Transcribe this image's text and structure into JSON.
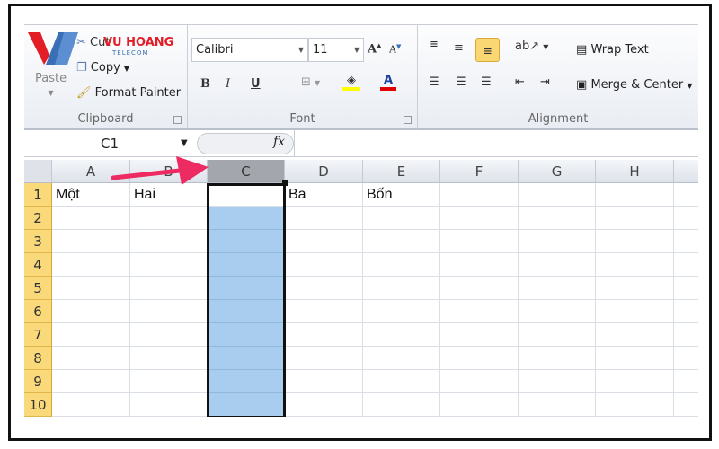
{
  "clipboard": {
    "cut": "Cut",
    "copy": "Copy",
    "paste": "Paste",
    "format_painter": "Format Painter",
    "label": "Clipboard"
  },
  "logo": {
    "brand": "VU HOANG",
    "sub": "TELECOM"
  },
  "font": {
    "name": "Calibri",
    "size": "11",
    "bold": "B",
    "italic": "I",
    "underline": "U",
    "label": "Font",
    "highlight_color": "#ffff00",
    "font_color": "#e00000"
  },
  "alignment": {
    "wrap_text": "Wrap Text",
    "merge_center": "Merge & Center",
    "label": "Alignment"
  },
  "formula_bar": {
    "name_box": "C1",
    "fx": "fx",
    "value": ""
  },
  "columns": [
    "A",
    "B",
    "C",
    "D",
    "E",
    "F",
    "G",
    "H"
  ],
  "selected_column": "C",
  "rows": [
    {
      "n": "1",
      "cells": [
        "Một",
        "Hai",
        "",
        "Ba",
        "Bốn",
        "",
        "",
        ""
      ]
    },
    {
      "n": "2",
      "cells": [
        "",
        "",
        "",
        "",
        "",
        "",
        "",
        ""
      ]
    },
    {
      "n": "3",
      "cells": [
        "",
        "",
        "",
        "",
        "",
        "",
        "",
        ""
      ]
    },
    {
      "n": "4",
      "cells": [
        "",
        "",
        "",
        "",
        "",
        "",
        "",
        ""
      ]
    },
    {
      "n": "5",
      "cells": [
        "",
        "",
        "",
        "",
        "",
        "",
        "",
        ""
      ]
    },
    {
      "n": "6",
      "cells": [
        "",
        "",
        "",
        "",
        "",
        "",
        "",
        ""
      ]
    },
    {
      "n": "7",
      "cells": [
        "",
        "",
        "",
        "",
        "",
        "",
        "",
        ""
      ]
    },
    {
      "n": "8",
      "cells": [
        "",
        "",
        "",
        "",
        "",
        "",
        "",
        ""
      ]
    },
    {
      "n": "9",
      "cells": [
        "",
        "",
        "",
        "",
        "",
        "",
        "",
        ""
      ]
    },
    {
      "n": "10",
      "cells": [
        "",
        "",
        "",
        "",
        "",
        "",
        "",
        ""
      ]
    }
  ],
  "colors": {
    "selection": "#a8cdef",
    "row_header": "#f9d97a",
    "arrow": "#ee2a62",
    "active_button": "#fbd774"
  }
}
